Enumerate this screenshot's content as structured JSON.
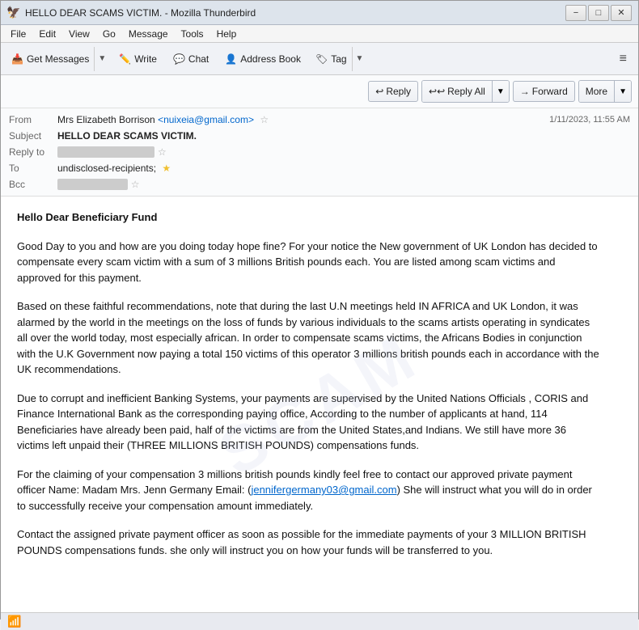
{
  "titleBar": {
    "icon": "🦅",
    "title": "HELLO DEAR SCAMS VICTIM. - Mozilla Thunderbird",
    "minimize": "−",
    "maximize": "□",
    "close": "✕"
  },
  "menuBar": {
    "items": [
      "File",
      "Edit",
      "View",
      "Go",
      "Message",
      "Tools",
      "Help"
    ]
  },
  "toolbar": {
    "getMessages": "Get Messages",
    "write": "Write",
    "chat": "Chat",
    "addressBook": "Address Book",
    "tag": "Tag",
    "hamburger": "≡"
  },
  "emailActions": {
    "reply": "Reply",
    "replyAll": "Reply All",
    "forward": "Forward",
    "more": "More"
  },
  "emailHeader": {
    "fromLabel": "From",
    "fromName": "Mrs Elizabeth Borrison",
    "fromEmail": "<nuixeia@gmail.com>",
    "subjectLabel": "Subject",
    "subject": "HELLO DEAR SCAMS VICTIM.",
    "replyToLabel": "Reply to",
    "replyToBlurred": "                              ",
    "toLabel": "To",
    "toValue": "undisclosed-recipients;",
    "bccLabel": "Bcc",
    "bccBlurred": "                    ",
    "date": "1/11/2023, 11:55 AM"
  },
  "emailBody": {
    "greeting": "Hello Dear Beneficiary Fund",
    "paragraph1": "Good Day to you and how are you doing today hope fine? For your notice the New government of UK London has decided to compensate every scam victim with a sum of 3 millions British pounds each. You are listed among scam victims and approved for this payment.",
    "paragraph2": "Based on these faithful recommendations, note that during the last U.N meetings held IN AFRICA and UK London, it was alarmed by the world in the meetings on the loss of funds by various individuals to the scams artists operating in syndicates all over the world today, most especially african. In order to compensate scams victims, the Africans Bodies in conjunction with the U.K Government now paying a total 150 victims of this operator 3 millions british pounds each in accordance with the UK recommendations.",
    "paragraph3": "Due to corrupt and inefficient Banking Systems, your payments are supervised by the United Nations Officials , CORIS and Finance International Bank as the corresponding paying office, According to the number of applicants at hand, 114 Beneficiaries have already been paid, half of the victims are from the United States,and Indians. We still have more 36 victims left unpaid their (THREE MILLIONS BRITISH POUNDS) compensations funds.",
    "paragraph4Pre": "For the claiming of your compensation 3 millions british pounds kindly feel free to contact our approved private payment officer Name: Madam Mrs. Jenn Germany Email: (",
    "paragraph4Link": "jennifergermany03@gmail.com",
    "paragraph4Post": ") She will instruct what you will do in order to successfully receive your compensation amount immediately.",
    "paragraph5": "Contact the assigned private payment officer as soon as possible for the immediate payments of your 3 MILLION BRITISH POUNDS compensations funds. she only will instruct you on how your funds will be transferred to you."
  },
  "statusBar": {
    "wifiIcon": "📶"
  }
}
